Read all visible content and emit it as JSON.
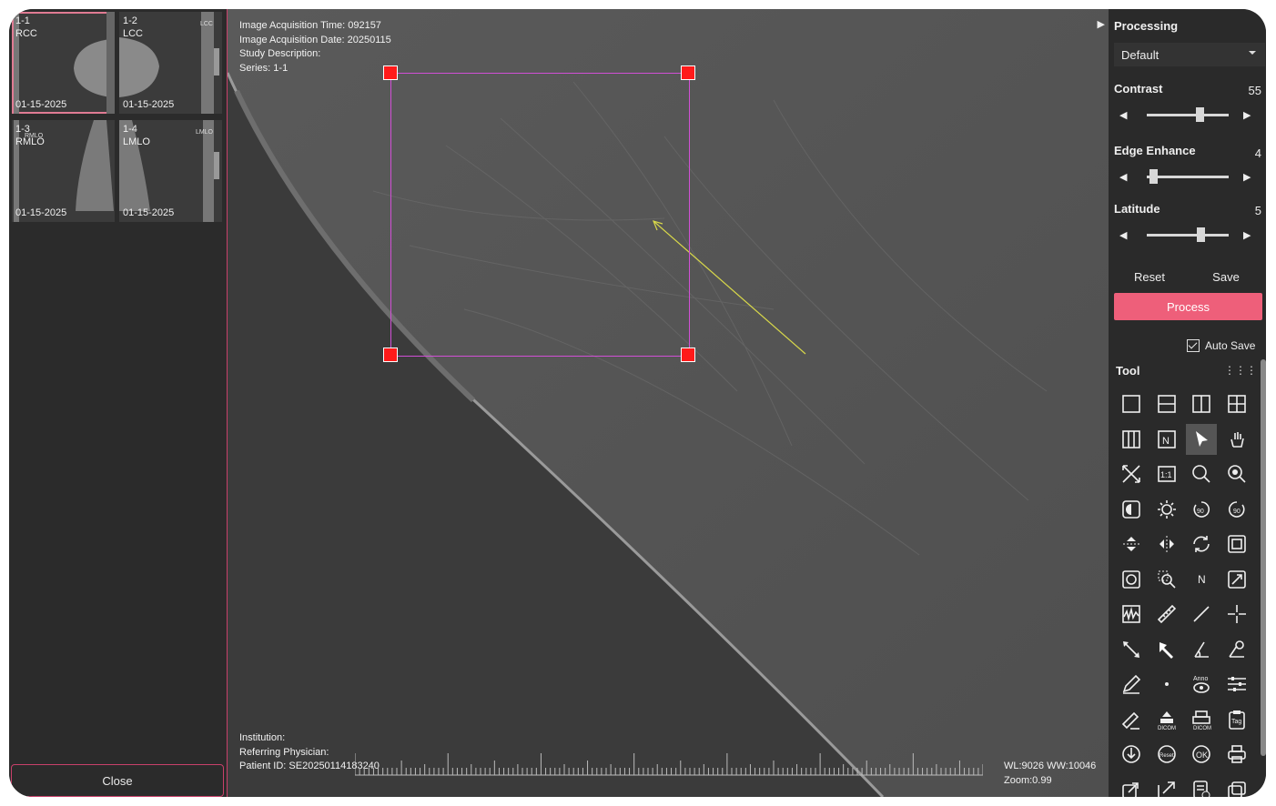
{
  "thumbnails": [
    {
      "id": "1-1",
      "view": "RCC",
      "small": "",
      "date": "01-15-2025",
      "selected": true
    },
    {
      "id": "1-2",
      "view": "LCC",
      "small": "LCC",
      "date": "01-15-2025",
      "selected": false
    },
    {
      "id": "1-3",
      "view": "RMLO",
      "small": "RMLO",
      "date": "01-15-2025",
      "selected": false
    },
    {
      "id": "1-4",
      "view": "LMLO",
      "small": "LMLO",
      "date": "01-15-2025",
      "selected": false
    }
  ],
  "close_label": "Close",
  "viewer": {
    "acq_time": "Image Acquisition Time: 092157",
    "acq_date": "Image Acquisition Date: 20250115",
    "study_desc": "Study Description:",
    "series": "Series: 1-1",
    "institution": "Institution:",
    "physician": "Referring Physician:",
    "patient_id": "Patient ID: SE20250114183240",
    "wlww": "WL:9026 WW:10046",
    "zoom": "Zoom:0.99"
  },
  "processing": {
    "title": "Processing",
    "preset": "Default",
    "params": [
      {
        "label": "Contrast",
        "value": "55",
        "level": 0.64
      },
      {
        "label": "Edge Enhance",
        "value": "4",
        "level": 0.08
      },
      {
        "label": "Latitude",
        "value": "5",
        "level": 0.66
      }
    ],
    "reset_label": "Reset",
    "save_label": "Save",
    "process_label": "Process",
    "autosave_label": "Auto Save"
  },
  "tool": {
    "title": "Tool",
    "icons": [
      "layout-1x1-icon",
      "layout-1x2-icon",
      "layout-2x1-icon",
      "layout-2x2-icon",
      "layout-3col-icon",
      "layout-n-icon",
      "pointer-icon",
      "pan-hand-icon",
      "fit-screen-icon",
      "actual-size-icon",
      "zoom-icon",
      "magnifier-icon",
      "invert-icon",
      "brightness-icon",
      "rotate-left-90-icon",
      "rotate-right-90-icon",
      "flip-vertical-icon",
      "flip-horizontal-icon",
      "reset-rotate-icon",
      "rectangle-roi-icon",
      "ellipse-roi-icon",
      "zoom-region-icon",
      "n-icon",
      "resize-icon",
      "histogram-icon",
      "ruler-icon",
      "line-icon",
      "crosshair-icon",
      "double-arrow-icon",
      "arrow-icon",
      "angle-icon",
      "cobb-angle-icon",
      "pencil-icon",
      "point-icon",
      "anno-eye-icon",
      "adjust-sliders-icon",
      "measure-edit-icon",
      "dicom-upload-icon",
      "dicom-print-icon",
      "tag-clipboard-icon",
      "download-icon",
      "reset-icon",
      "ok-icon",
      "printer-icon",
      "export-icon",
      "export-arrow-icon",
      "report-icon",
      "copy-window-icon"
    ],
    "labels": {
      "actual": "1:1",
      "n": "N",
      "anno": "Anno",
      "dicom": "DICOM",
      "tag": "Tag",
      "reset": "Reset",
      "ok": "OK"
    }
  }
}
